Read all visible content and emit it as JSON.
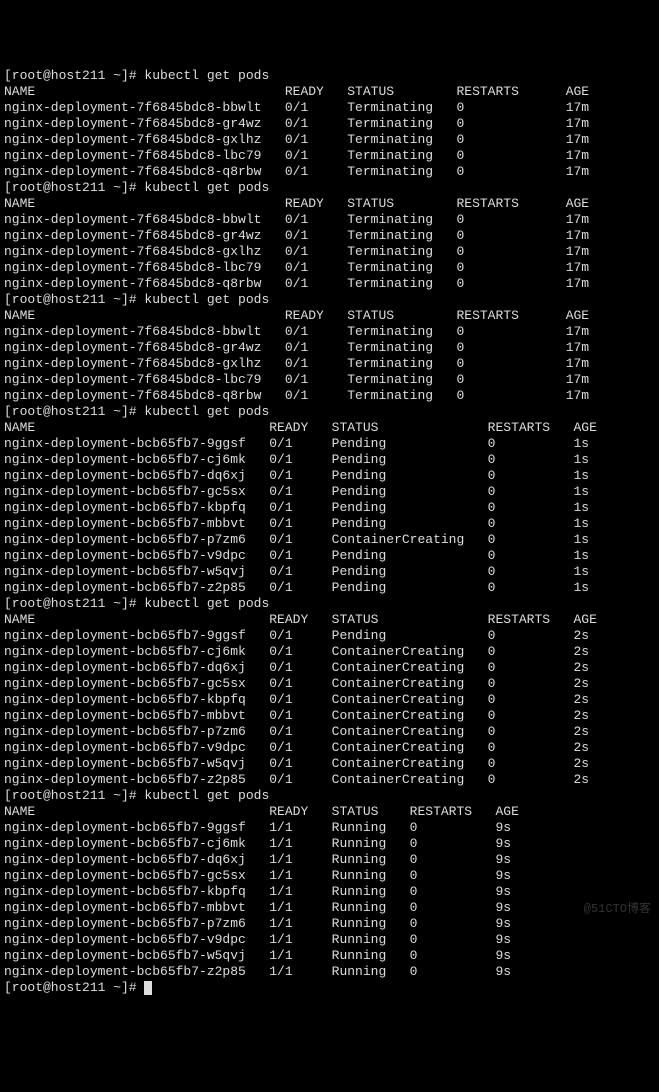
{
  "prompt": {
    "user": "root",
    "host": "host211",
    "path": "~",
    "command": "kubectl get pods"
  },
  "watermark": "@51CTO博客",
  "blocks": [
    {
      "header": [
        "NAME",
        "READY",
        "STATUS",
        "RESTARTS",
        "AGE"
      ],
      "cols": [
        0,
        36,
        44,
        58,
        72
      ],
      "rows": [
        [
          "nginx-deployment-7f6845bdc8-bbwlt",
          "0/1",
          "Terminating",
          "0",
          "17m"
        ],
        [
          "nginx-deployment-7f6845bdc8-gr4wz",
          "0/1",
          "Terminating",
          "0",
          "17m"
        ],
        [
          "nginx-deployment-7f6845bdc8-gxlhz",
          "0/1",
          "Terminating",
          "0",
          "17m"
        ],
        [
          "nginx-deployment-7f6845bdc8-lbc79",
          "0/1",
          "Terminating",
          "0",
          "17m"
        ],
        [
          "nginx-deployment-7f6845bdc8-q8rbw",
          "0/1",
          "Terminating",
          "0",
          "17m"
        ]
      ]
    },
    {
      "header": [
        "NAME",
        "READY",
        "STATUS",
        "RESTARTS",
        "AGE"
      ],
      "cols": [
        0,
        36,
        44,
        58,
        72
      ],
      "rows": [
        [
          "nginx-deployment-7f6845bdc8-bbwlt",
          "0/1",
          "Terminating",
          "0",
          "17m"
        ],
        [
          "nginx-deployment-7f6845bdc8-gr4wz",
          "0/1",
          "Terminating",
          "0",
          "17m"
        ],
        [
          "nginx-deployment-7f6845bdc8-gxlhz",
          "0/1",
          "Terminating",
          "0",
          "17m"
        ],
        [
          "nginx-deployment-7f6845bdc8-lbc79",
          "0/1",
          "Terminating",
          "0",
          "17m"
        ],
        [
          "nginx-deployment-7f6845bdc8-q8rbw",
          "0/1",
          "Terminating",
          "0",
          "17m"
        ]
      ]
    },
    {
      "header": [
        "NAME",
        "READY",
        "STATUS",
        "RESTARTS",
        "AGE"
      ],
      "cols": [
        0,
        36,
        44,
        58,
        72
      ],
      "rows": [
        [
          "nginx-deployment-7f6845bdc8-bbwlt",
          "0/1",
          "Terminating",
          "0",
          "17m"
        ],
        [
          "nginx-deployment-7f6845bdc8-gr4wz",
          "0/1",
          "Terminating",
          "0",
          "17m"
        ],
        [
          "nginx-deployment-7f6845bdc8-gxlhz",
          "0/1",
          "Terminating",
          "0",
          "17m"
        ],
        [
          "nginx-deployment-7f6845bdc8-lbc79",
          "0/1",
          "Terminating",
          "0",
          "17m"
        ],
        [
          "nginx-deployment-7f6845bdc8-q8rbw",
          "0/1",
          "Terminating",
          "0",
          "17m"
        ]
      ]
    },
    {
      "header": [
        "NAME",
        "READY",
        "STATUS",
        "RESTARTS",
        "AGE"
      ],
      "cols": [
        0,
        34,
        42,
        62,
        73
      ],
      "rows": [
        [
          "nginx-deployment-bcb65fb7-9ggsf",
          "0/1",
          "Pending",
          "0",
          "1s"
        ],
        [
          "nginx-deployment-bcb65fb7-cj6mk",
          "0/1",
          "Pending",
          "0",
          "1s"
        ],
        [
          "nginx-deployment-bcb65fb7-dq6xj",
          "0/1",
          "Pending",
          "0",
          "1s"
        ],
        [
          "nginx-deployment-bcb65fb7-gc5sx",
          "0/1",
          "Pending",
          "0",
          "1s"
        ],
        [
          "nginx-deployment-bcb65fb7-kbpfq",
          "0/1",
          "Pending",
          "0",
          "1s"
        ],
        [
          "nginx-deployment-bcb65fb7-mbbvt",
          "0/1",
          "Pending",
          "0",
          "1s"
        ],
        [
          "nginx-deployment-bcb65fb7-p7zm6",
          "0/1",
          "ContainerCreating",
          "0",
          "1s"
        ],
        [
          "nginx-deployment-bcb65fb7-v9dpc",
          "0/1",
          "Pending",
          "0",
          "1s"
        ],
        [
          "nginx-deployment-bcb65fb7-w5qvj",
          "0/1",
          "Pending",
          "0",
          "1s"
        ],
        [
          "nginx-deployment-bcb65fb7-z2p85",
          "0/1",
          "Pending",
          "0",
          "1s"
        ]
      ]
    },
    {
      "header": [
        "NAME",
        "READY",
        "STATUS",
        "RESTARTS",
        "AGE"
      ],
      "cols": [
        0,
        34,
        42,
        62,
        73
      ],
      "rows": [
        [
          "nginx-deployment-bcb65fb7-9ggsf",
          "0/1",
          "Pending",
          "0",
          "2s"
        ],
        [
          "nginx-deployment-bcb65fb7-cj6mk",
          "0/1",
          "ContainerCreating",
          "0",
          "2s"
        ],
        [
          "nginx-deployment-bcb65fb7-dq6xj",
          "0/1",
          "ContainerCreating",
          "0",
          "2s"
        ],
        [
          "nginx-deployment-bcb65fb7-gc5sx",
          "0/1",
          "ContainerCreating",
          "0",
          "2s"
        ],
        [
          "nginx-deployment-bcb65fb7-kbpfq",
          "0/1",
          "ContainerCreating",
          "0",
          "2s"
        ],
        [
          "nginx-deployment-bcb65fb7-mbbvt",
          "0/1",
          "ContainerCreating",
          "0",
          "2s"
        ],
        [
          "nginx-deployment-bcb65fb7-p7zm6",
          "0/1",
          "ContainerCreating",
          "0",
          "2s"
        ],
        [
          "nginx-deployment-bcb65fb7-v9dpc",
          "0/1",
          "ContainerCreating",
          "0",
          "2s"
        ],
        [
          "nginx-deployment-bcb65fb7-w5qvj",
          "0/1",
          "ContainerCreating",
          "0",
          "2s"
        ],
        [
          "nginx-deployment-bcb65fb7-z2p85",
          "0/1",
          "ContainerCreating",
          "0",
          "2s"
        ]
      ]
    },
    {
      "header": [
        "NAME",
        "READY",
        "STATUS",
        "RESTARTS",
        "AGE"
      ],
      "cols": [
        0,
        34,
        42,
        52,
        63
      ],
      "rows": [
        [
          "nginx-deployment-bcb65fb7-9ggsf",
          "1/1",
          "Running",
          "0",
          "9s"
        ],
        [
          "nginx-deployment-bcb65fb7-cj6mk",
          "1/1",
          "Running",
          "0",
          "9s"
        ],
        [
          "nginx-deployment-bcb65fb7-dq6xj",
          "1/1",
          "Running",
          "0",
          "9s"
        ],
        [
          "nginx-deployment-bcb65fb7-gc5sx",
          "1/1",
          "Running",
          "0",
          "9s"
        ],
        [
          "nginx-deployment-bcb65fb7-kbpfq",
          "1/1",
          "Running",
          "0",
          "9s"
        ],
        [
          "nginx-deployment-bcb65fb7-mbbvt",
          "1/1",
          "Running",
          "0",
          "9s"
        ],
        [
          "nginx-deployment-bcb65fb7-p7zm6",
          "1/1",
          "Running",
          "0",
          "9s"
        ],
        [
          "nginx-deployment-bcb65fb7-v9dpc",
          "1/1",
          "Running",
          "0",
          "9s"
        ],
        [
          "nginx-deployment-bcb65fb7-w5qvj",
          "1/1",
          "Running",
          "0",
          "9s"
        ],
        [
          "nginx-deployment-bcb65fb7-z2p85",
          "1/1",
          "Running",
          "0",
          "9s"
        ]
      ]
    }
  ]
}
